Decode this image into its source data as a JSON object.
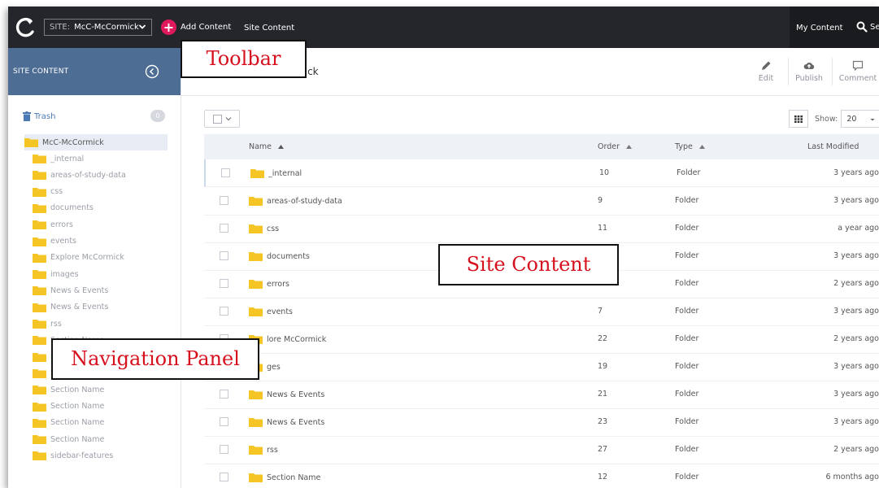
{
  "topbar": {
    "site_prefix": "SITE:",
    "site_value": "McC-McCormick",
    "add_content": "Add Content",
    "site_content": "Site Content",
    "my_content": "My Content",
    "search_partial": "Se"
  },
  "sidebar": {
    "title": "SITE CONTENT",
    "trash_label": "Trash",
    "trash_count": "0",
    "root": "McC-McCormick",
    "items": [
      "_internal",
      "areas-of-study-data",
      "css",
      "documents",
      "errors",
      "events",
      "Explore McCormick",
      "images",
      "News & Events",
      "News & Events",
      "rss",
      "Section Name",
      "Section Name",
      "Section Name",
      "Section Name",
      "Section Name",
      "Section Name",
      "Section Name",
      "sidebar-features"
    ]
  },
  "main": {
    "title_partial": "ormick",
    "toolbar": {
      "edit": "Edit",
      "publish": "Publish",
      "comment": "Comment"
    },
    "show_label": "Show:",
    "show_value": "20",
    "columns": {
      "name": "Name",
      "order": "Order",
      "type": "Type",
      "modified": "Last Modified"
    },
    "rows": [
      {
        "name": "_internal",
        "order": "10",
        "type": "Folder",
        "modified": "3 years ago"
      },
      {
        "name": "areas-of-study-data",
        "order": "9",
        "type": "Folder",
        "modified": "3 years ago"
      },
      {
        "name": "css",
        "order": "11",
        "type": "Folder",
        "modified": "a year ago"
      },
      {
        "name": "documents",
        "order": "",
        "type": "Folder",
        "modified": "3 years ago"
      },
      {
        "name": "errors",
        "order": "",
        "type": "Folder",
        "modified": "2 years ago"
      },
      {
        "name": "events",
        "order": "7",
        "type": "Folder",
        "modified": "3 years ago"
      },
      {
        "name": "lore McCormick",
        "order": "22",
        "type": "Folder",
        "modified": "2 years ago"
      },
      {
        "name": "ges",
        "order": "19",
        "type": "Folder",
        "modified": "3 years ago"
      },
      {
        "name": "News & Events",
        "order": "21",
        "type": "Folder",
        "modified": "3 years ago"
      },
      {
        "name": "News & Events",
        "order": "23",
        "type": "Folder",
        "modified": "3 years ago"
      },
      {
        "name": "rss",
        "order": "27",
        "type": "Folder",
        "modified": "2 years ago"
      },
      {
        "name": "Section Name",
        "order": "12",
        "type": "Folder",
        "modified": "6 months ago"
      }
    ]
  },
  "annotations": {
    "toolbar": "Toolbar",
    "site_content": "Site Content",
    "navigation_panel": "Navigation Panel"
  },
  "colors": {
    "topbar": "#24262c",
    "sidebar_header": "#4e6d95",
    "folder": "#f5c425",
    "add_button": "#e0195c",
    "callout_text": "#d7101e",
    "link": "#4b79b6"
  }
}
